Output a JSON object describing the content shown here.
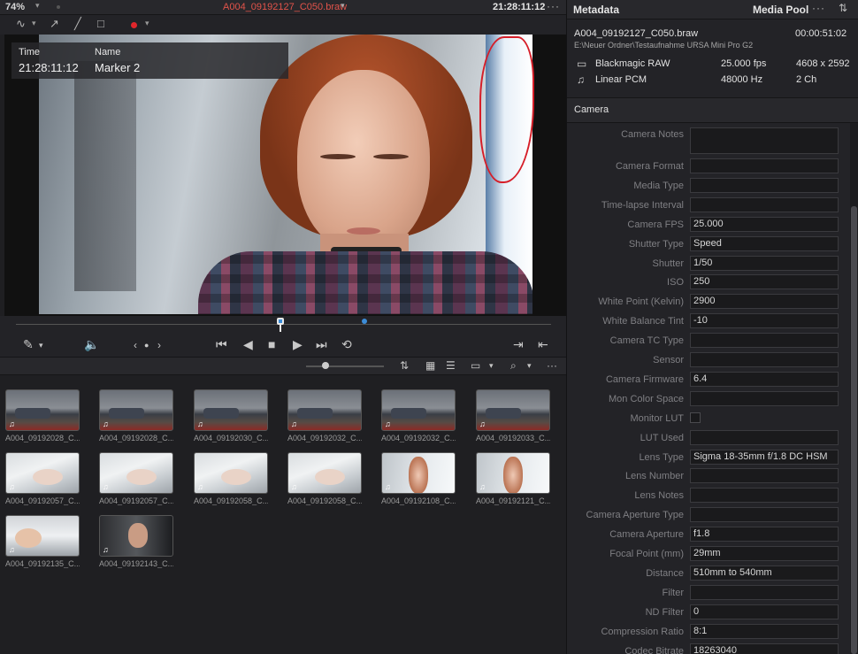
{
  "viewer": {
    "zoom": "74%",
    "clip_title": "A004_09192127_C050.braw",
    "timecode": "21:28:11:12",
    "marker": {
      "time_label": "Time",
      "name_label": "Name",
      "time_value": "21:28:11:12",
      "name_value": "Marker 2"
    }
  },
  "media_pool": {
    "clips": [
      {
        "name": "A004_09192028_C...",
        "thumb": "room",
        "audio": true
      },
      {
        "name": "A004_09192028_C...",
        "thumb": "room",
        "audio": true
      },
      {
        "name": "A004_09192030_C...",
        "thumb": "room",
        "audio": true
      },
      {
        "name": "A004_09192032_C...",
        "thumb": "room",
        "audio": true
      },
      {
        "name": "A004_09192032_C...",
        "thumb": "room",
        "audio": true
      },
      {
        "name": "A004_09192033_C...",
        "thumb": "room",
        "audio": true
      },
      {
        "name": "A004_09192057_C...",
        "thumb": "bed",
        "audio": true
      },
      {
        "name": "A004_09192057_C...",
        "thumb": "bed",
        "audio": true
      },
      {
        "name": "A004_09192058_C...",
        "thumb": "bed",
        "audio": true
      },
      {
        "name": "A004_09192058_C...",
        "thumb": "bed",
        "audio": true
      },
      {
        "name": "A004_09192108_C...",
        "thumb": "face",
        "audio": true
      },
      {
        "name": "A004_09192121_C...",
        "thumb": "face",
        "audio": true
      },
      {
        "name": "A004_09192135_C...",
        "thumb": "sofa",
        "audio": true
      },
      {
        "name": "A004_09192143_C...",
        "thumb": "dark",
        "audio": true
      }
    ]
  },
  "panel": {
    "metadata_tab": "Metadata",
    "media_pool_tab": "Media Pool",
    "clip": {
      "name": "A004_09192127_C050.braw",
      "duration": "00:00:51:02",
      "path": "E:\\Neuer Ordner\\Testaufnahme URSA Mini Pro G2",
      "video_codec": "Blackmagic RAW",
      "fps": "25.000 fps",
      "resolution": "4608 x 2592",
      "audio_codec": "Linear PCM",
      "sample_rate": "48000 Hz",
      "channels": "2 Ch"
    },
    "section": "Camera",
    "fields": [
      {
        "label": "Camera Notes",
        "value": "",
        "type": "tall"
      },
      {
        "label": "Camera Format",
        "value": ""
      },
      {
        "label": "Media Type",
        "value": ""
      },
      {
        "label": "Time-lapse Interval",
        "value": ""
      },
      {
        "label": "Camera FPS",
        "value": "25.000"
      },
      {
        "label": "Shutter Type",
        "value": "Speed"
      },
      {
        "label": "Shutter",
        "value": "1/50"
      },
      {
        "label": "ISO",
        "value": "250"
      },
      {
        "label": "White Point (Kelvin)",
        "value": "2900"
      },
      {
        "label": "White Balance Tint",
        "value": "-10"
      },
      {
        "label": "Camera TC Type",
        "value": ""
      },
      {
        "label": "Sensor",
        "value": ""
      },
      {
        "label": "Camera Firmware",
        "value": "6.4"
      },
      {
        "label": "Mon Color Space",
        "value": ""
      },
      {
        "label": "Monitor LUT",
        "value": "",
        "type": "check"
      },
      {
        "label": "LUT Used",
        "value": ""
      },
      {
        "label": "Lens Type",
        "value": "Sigma 18-35mm f/1.8 DC HSM"
      },
      {
        "label": "Lens Number",
        "value": ""
      },
      {
        "label": "Lens Notes",
        "value": ""
      },
      {
        "label": "Camera Aperture Type",
        "value": ""
      },
      {
        "label": "Camera Aperture",
        "value": "f1.8"
      },
      {
        "label": "Focal Point (mm)",
        "value": "29mm"
      },
      {
        "label": "Distance",
        "value": "510mm to 540mm"
      },
      {
        "label": "Filter",
        "value": ""
      },
      {
        "label": "ND Filter",
        "value": "0"
      },
      {
        "label": "Compression Ratio",
        "value": "8:1"
      },
      {
        "label": "Codec Bitrate",
        "value": "18263040"
      }
    ]
  }
}
